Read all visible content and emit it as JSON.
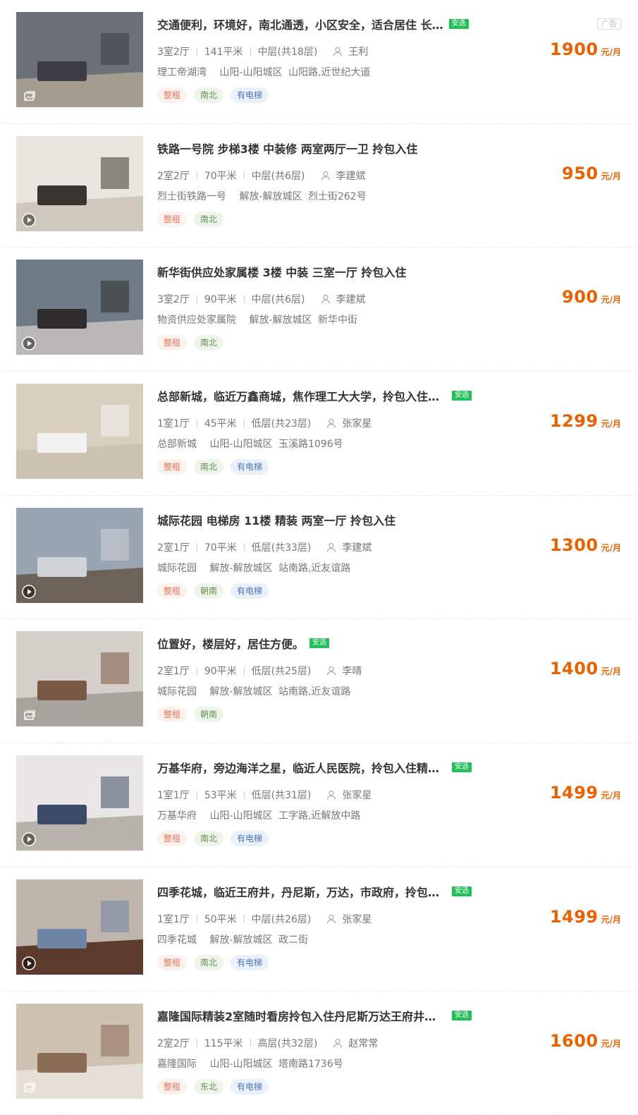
{
  "listings": [
    {
      "title": "交通便利，环境好，南北通透，小区安全，适合居住 长…",
      "anxuan": "安选",
      "ad": "广告",
      "layout": "3室2厅",
      "area": "141平米",
      "floor": "中层(共18层)",
      "agent": "王利",
      "community": "理工帝湖湾",
      "district": "山阳-山阳城区",
      "street": "山阳路,近世纪大道",
      "tags": [
        {
          "text": "整租",
          "kind": "red"
        },
        {
          "text": "南北",
          "kind": "green"
        },
        {
          "text": "有电梯",
          "kind": "blue"
        }
      ],
      "price": "1900",
      "unit": "元/月",
      "media": "photo-icon"
    },
    {
      "title": "铁路一号院 步梯3楼 中装修 两室两厅一卫 拎包入住",
      "anxuan": "",
      "ad": "",
      "layout": "2室2厅",
      "area": "70平米",
      "floor": "中层(共6层)",
      "agent": "李建斌",
      "community": "烈士街铁路一号",
      "district": "解放-解放城区",
      "street": "烈士街262号",
      "tags": [
        {
          "text": "整租",
          "kind": "red"
        },
        {
          "text": "南北",
          "kind": "green"
        }
      ],
      "price": "950",
      "unit": "元/月",
      "media": "play-icon"
    },
    {
      "title": "新华街供应处家属楼 3楼 中装 三室一厅 拎包入住",
      "anxuan": "",
      "ad": "",
      "layout": "3室2厅",
      "area": "90平米",
      "floor": "中层(共6层)",
      "agent": "李建斌",
      "community": "物资供应处家属院",
      "district": "解放-解放城区",
      "street": "新华中街",
      "tags": [
        {
          "text": "整租",
          "kind": "red"
        },
        {
          "text": "南北",
          "kind": "green"
        }
      ],
      "price": "900",
      "unit": "元/月",
      "media": "play-icon"
    },
    {
      "title": "总部新城，临近万鑫商城，焦作理工大大学，拎包入住，…",
      "anxuan": "安选",
      "ad": "",
      "layout": "1室1厅",
      "area": "45平米",
      "floor": "低层(共23层)",
      "agent": "张家星",
      "community": "总部新城",
      "district": "山阳-山阳城区",
      "street": "玉溪路1096号",
      "tags": [
        {
          "text": "整租",
          "kind": "red"
        },
        {
          "text": "南北",
          "kind": "green"
        },
        {
          "text": "有电梯",
          "kind": "blue"
        }
      ],
      "price": "1299",
      "unit": "元/月",
      "media": ""
    },
    {
      "title": "城际花园 电梯房 11楼 精装 两室一厅 拎包入住",
      "anxuan": "",
      "ad": "",
      "layout": "2室1厅",
      "area": "70平米",
      "floor": "低层(共33层)",
      "agent": "李建斌",
      "community": "城际花园",
      "district": "解放-解放城区",
      "street": "站南路,近友谊路",
      "tags": [
        {
          "text": "整租",
          "kind": "red"
        },
        {
          "text": "朝南",
          "kind": "green"
        },
        {
          "text": "有电梯",
          "kind": "blue"
        }
      ],
      "price": "1300",
      "unit": "元/月",
      "media": "play-icon"
    },
    {
      "title": "位置好，楼层好，居住方便。",
      "anxuan": "安选",
      "ad": "",
      "layout": "2室1厅",
      "area": "90平米",
      "floor": "低层(共25层)",
      "agent": "李晴",
      "community": "城际花园",
      "district": "解放-解放城区",
      "street": "站南路,近友谊路",
      "tags": [
        {
          "text": "整租",
          "kind": "red"
        },
        {
          "text": "朝南",
          "kind": "green"
        }
      ],
      "price": "1400",
      "unit": "元/月",
      "media": "photo-icon"
    },
    {
      "title": "万基华府，旁边海洋之星，临近人民医院，拎包入住精装房",
      "anxuan": "安选",
      "ad": "",
      "layout": "1室1厅",
      "area": "53平米",
      "floor": "低层(共31层)",
      "agent": "张家星",
      "community": "万基华府",
      "district": "山阳-山阳城区",
      "street": "工字路,近解放中路",
      "tags": [
        {
          "text": "整租",
          "kind": "red"
        },
        {
          "text": "南北",
          "kind": "green"
        },
        {
          "text": "有电梯",
          "kind": "blue"
        }
      ],
      "price": "1499",
      "unit": "元/月",
      "media": "play-icon"
    },
    {
      "title": "四季花城，临近王府井，丹尼斯，万达，市政府，拎包入…",
      "anxuan": "安选",
      "ad": "",
      "layout": "1室1厅",
      "area": "50平米",
      "floor": "中层(共26层)",
      "agent": "张家星",
      "community": "四季花城",
      "district": "解放-解放城区",
      "street": "政二街",
      "tags": [
        {
          "text": "整租",
          "kind": "red"
        },
        {
          "text": "南北",
          "kind": "green"
        },
        {
          "text": "有电梯",
          "kind": "blue"
        }
      ],
      "price": "1499",
      "unit": "元/月",
      "media": "play-icon"
    },
    {
      "title": "嘉隆国际精装2室随时看房拎包入住丹尼斯万达王府井龙…",
      "anxuan": "安选",
      "ad": "",
      "layout": "2室2厅",
      "area": "115平米",
      "floor": "高层(共32层)",
      "agent": "赵常常",
      "community": "嘉隆国际",
      "district": "山阳-山阳城区",
      "street": "塔南路1736号",
      "tags": [
        {
          "text": "整租",
          "kind": "red"
        },
        {
          "text": "东北",
          "kind": "green"
        },
        {
          "text": "有电梯",
          "kind": "blue"
        }
      ],
      "price": "1600",
      "unit": "元/月",
      "media": "photo-icon"
    }
  ],
  "palette": {
    "price": "#ea6100",
    "anxuan": "#21c15a"
  }
}
